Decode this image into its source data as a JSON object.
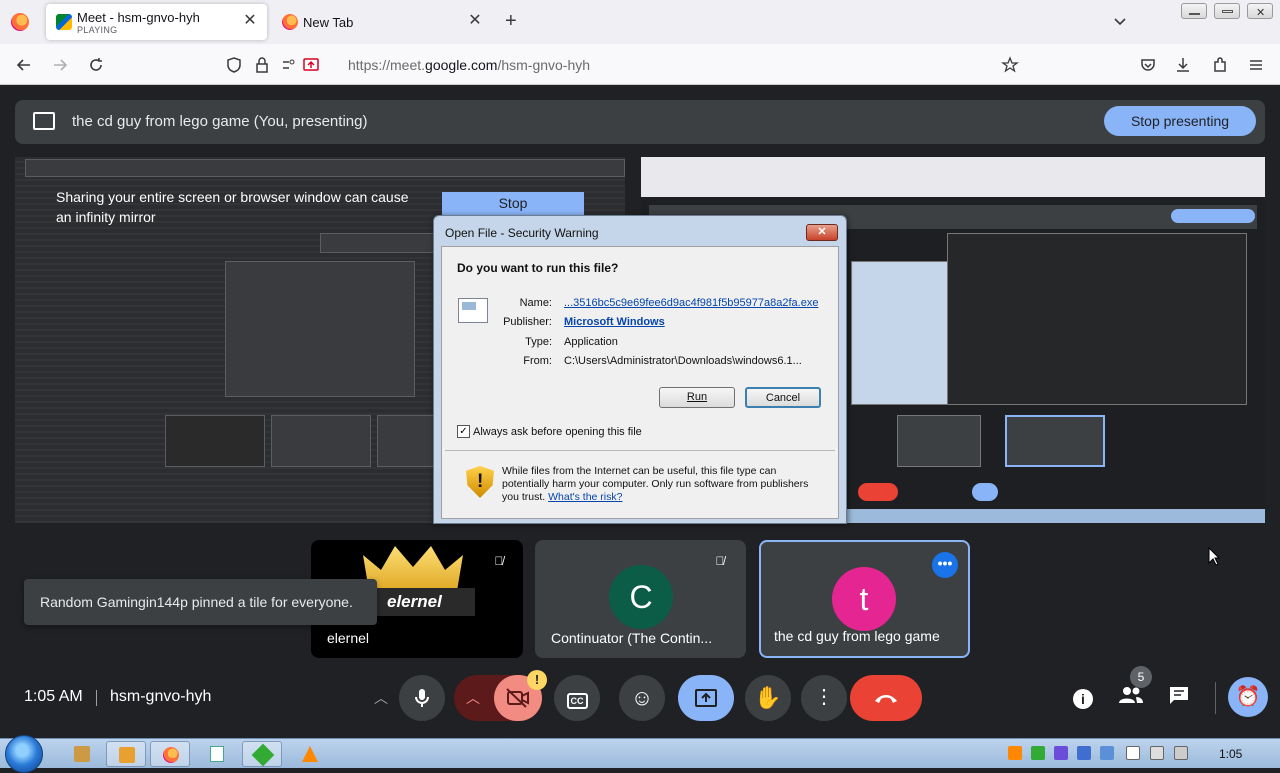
{
  "browser": {
    "tabs": [
      {
        "title": "Meet - hsm-gnvo-hyh",
        "subtitle": "PLAYING"
      },
      {
        "title": "New Tab"
      }
    ],
    "new_tab_label": "+",
    "url_prefix": "https://meet.",
    "url_domain": "google.com",
    "url_path": "/hsm-gnvo-hyh"
  },
  "presenting_bar": {
    "title": "the cd guy from lego game (You, presenting)",
    "stop_label": "Stop presenting"
  },
  "share_preview": {
    "warning": "Sharing your entire screen or browser window can cause an infinity mirror",
    "stop_label": "Stop"
  },
  "dialog": {
    "title": "Open File - Security Warning",
    "question": "Do you want to run this file?",
    "fields": [
      {
        "key": "Name:",
        "value": "...3516bc5c9e69fee6d9ac4f981f5b95977a8a2fa.exe"
      },
      {
        "key": "Publisher:",
        "value": "Microsoft Windows"
      },
      {
        "key": "Type:",
        "value": "Application"
      },
      {
        "key": "From:",
        "value": "C:\\Users\\Administrator\\Downloads\\windows6.1..."
      }
    ],
    "run_label": "Run",
    "cancel_label": "Cancel",
    "checkbox_label": "Always ask before opening this file",
    "checkbox_checked": true,
    "note": "While files from the Internet can be useful, this file type can potentially harm your computer. Only run software from publishers you trust.",
    "risk_link": "What's the risk?"
  },
  "tiles": [
    {
      "name": "elernel",
      "band": "elernel",
      "muted": true
    },
    {
      "name": "Continuator (The Contin...",
      "initial": "C",
      "muted": true,
      "avatar_color": "#0b5d47"
    },
    {
      "name": "the cd guy from lego game",
      "initial": "t",
      "avatar_color": "#e52592",
      "pinned": true
    }
  ],
  "toast": "Random Gamingin144p pinned a tile for everyone.",
  "footer": {
    "time": "1:05 AM",
    "meeting_code": "hsm-gnvo-hyh",
    "participants_count": "5",
    "camera_warning": "!"
  },
  "taskbar": {
    "clock": "1:05"
  },
  "colors": {
    "meet_bg": "#202124",
    "accent": "#8ab4f8",
    "end_call": "#ea4335",
    "camera_off": "#f28b82",
    "pin_blue": "#1a73e8"
  }
}
